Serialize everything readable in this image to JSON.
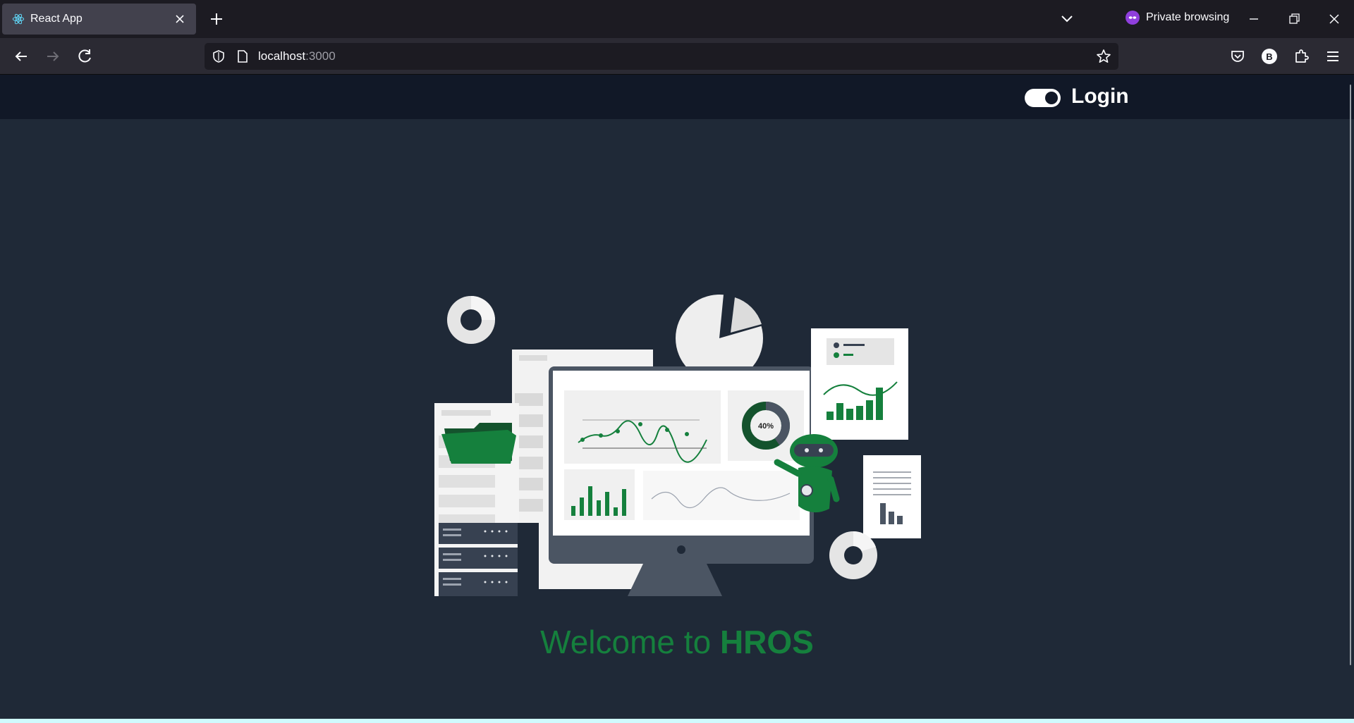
{
  "browser": {
    "tab": {
      "title": "React App",
      "favicon": "react-icon"
    },
    "private_label": "Private browsing",
    "url": {
      "host": "localhost",
      "port": ":3000"
    }
  },
  "app": {
    "login_label": "Login",
    "welcome_text": "Welcome to ",
    "brand": "HROS",
    "hero_donut_label": "40%"
  },
  "colors": {
    "accent_green": "#15803d",
    "page_bg": "#1f2937",
    "header_bg": "#111827"
  }
}
